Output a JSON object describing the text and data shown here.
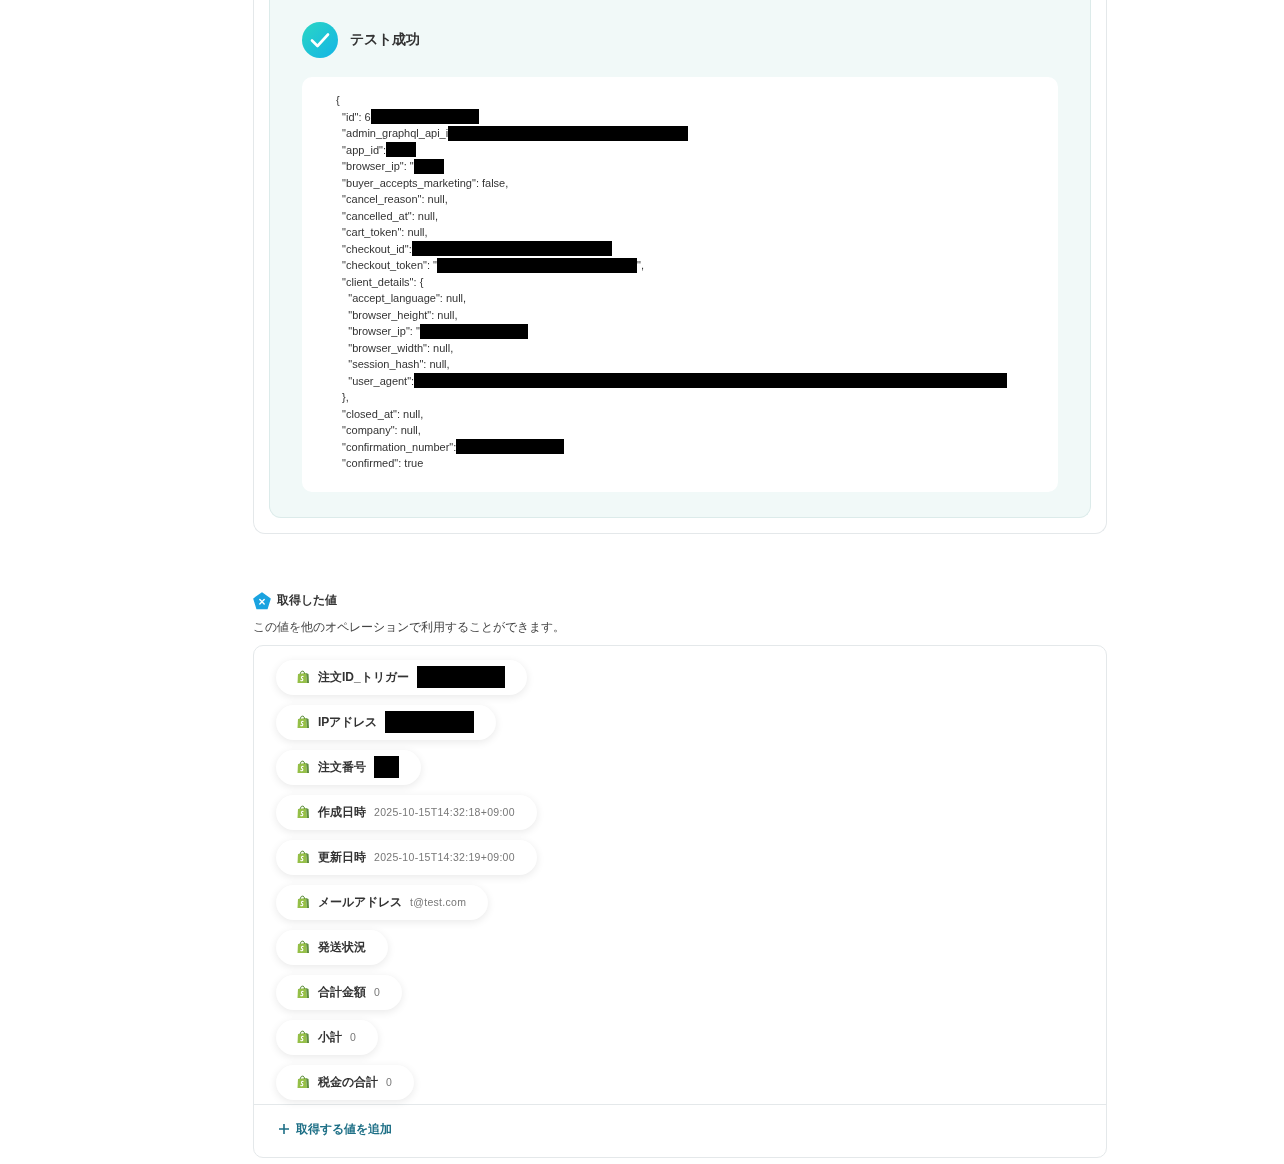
{
  "test_result": {
    "title": "テスト成功",
    "success": true,
    "code_lines": [
      {
        "text": "{",
        "kind": "plain"
      },
      {
        "text": "  \"id\": 6",
        "kind": "medium"
      },
      {
        "text": "  \"admin_graphql_api_i",
        "kind": "xlong"
      },
      {
        "text": "  \"app_id\":",
        "kind": "short"
      },
      {
        "text": "  \"browser_ip\": \"",
        "kind": "short"
      },
      {
        "text": "  \"buyer_accepts_marketing\": false,",
        "kind": "plain"
      },
      {
        "text": "  \"cancel_reason\": null,",
        "kind": "plain"
      },
      {
        "text": "  \"cancelled_at\": null,",
        "kind": "plain"
      },
      {
        "text": "  \"cart_token\": null,",
        "kind": "plain"
      },
      {
        "text": "  \"checkout_id\":",
        "kind": "long"
      },
      {
        "text": "  \"checkout_token\": \"",
        "kind": "long",
        "after": "\","
      },
      {
        "text": "  \"client_details\": {",
        "kind": "plain"
      },
      {
        "text": "    \"accept_language\": null,",
        "kind": "plain"
      },
      {
        "text": "    \"browser_height\": null,",
        "kind": "plain"
      },
      {
        "text": "    \"browser_ip\": \"",
        "kind": "medium"
      },
      {
        "text": "    \"browser_width\": null,",
        "kind": "plain"
      },
      {
        "text": "    \"session_hash\": null,",
        "kind": "plain"
      },
      {
        "text": "    \"user_agent\":",
        "kind": "full"
      },
      {
        "text": "  },",
        "kind": "plain"
      },
      {
        "text": "  \"closed_at\": null,",
        "kind": "plain"
      },
      {
        "text": "  \"company\": null,",
        "kind": "plain"
      },
      {
        "text": "  \"confirmation_number\":",
        "kind": "medium"
      },
      {
        "text": "  \"confirmed\": true",
        "kind": "plain"
      }
    ]
  },
  "retrieved_values": {
    "title": "取得した値",
    "description": "この値を他のオペレーションで利用することができます。",
    "items": [
      {
        "label": "注文ID_トリガー",
        "kind": "medium"
      },
      {
        "label": "IPアドレス",
        "kind": "medium"
      },
      {
        "label": "注文番号",
        "kind": "short"
      },
      {
        "label": "作成日時",
        "value": "2025-10-15T14:32:18+09:00",
        "kind": "plain"
      },
      {
        "label": "更新日時",
        "value": "2025-10-15T14:32:19+09:00",
        "kind": "plain"
      },
      {
        "label": "メールアドレス",
        "value": "t@test.com",
        "kind": "plain"
      },
      {
        "label": "発送状況",
        "kind": "plain"
      },
      {
        "label": "合計金額",
        "value": "0",
        "kind": "plain"
      },
      {
        "label": "小計",
        "value": "0",
        "kind": "plain"
      },
      {
        "label": "税金の合計",
        "value": "0",
        "kind": "plain"
      }
    ],
    "add_button": {
      "label": "取得する値を追加"
    }
  }
}
